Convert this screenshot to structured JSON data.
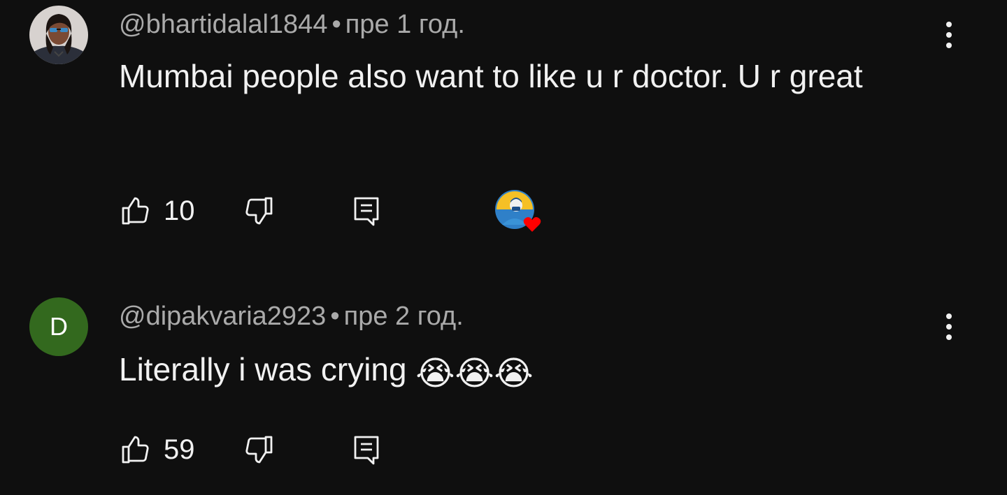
{
  "comments": [
    {
      "author": "@bhartidalal1844",
      "separator": "•",
      "time": "пре 1 год.",
      "text": "Mumbai  people also want to  like u r doctor.  U r great",
      "likes": "10",
      "avatar_type": "photo",
      "creator_heart": true,
      "icons": {
        "like": "thumbs-up-icon",
        "dislike": "thumbs-down-icon",
        "reply": "reply-icon",
        "menu": "more-vert-icon"
      }
    },
    {
      "author": "@dipakvaria2923",
      "separator": "•",
      "time": "пре 2 год.",
      "text": "Literally i was crying ",
      "emoji": "😭😭😭",
      "likes": "59",
      "avatar_type": "letter",
      "avatar_letter": "D",
      "avatar_color": "#33691e",
      "creator_heart": false,
      "icons": {
        "like": "thumbs-up-icon",
        "dislike": "thumbs-down-icon",
        "reply": "reply-icon",
        "menu": "more-vert-icon"
      }
    }
  ],
  "colors": {
    "background": "#0f0f0f",
    "text_primary": "#f1f1f1",
    "text_secondary": "#aaaaaa",
    "heart": "#ff0000"
  }
}
